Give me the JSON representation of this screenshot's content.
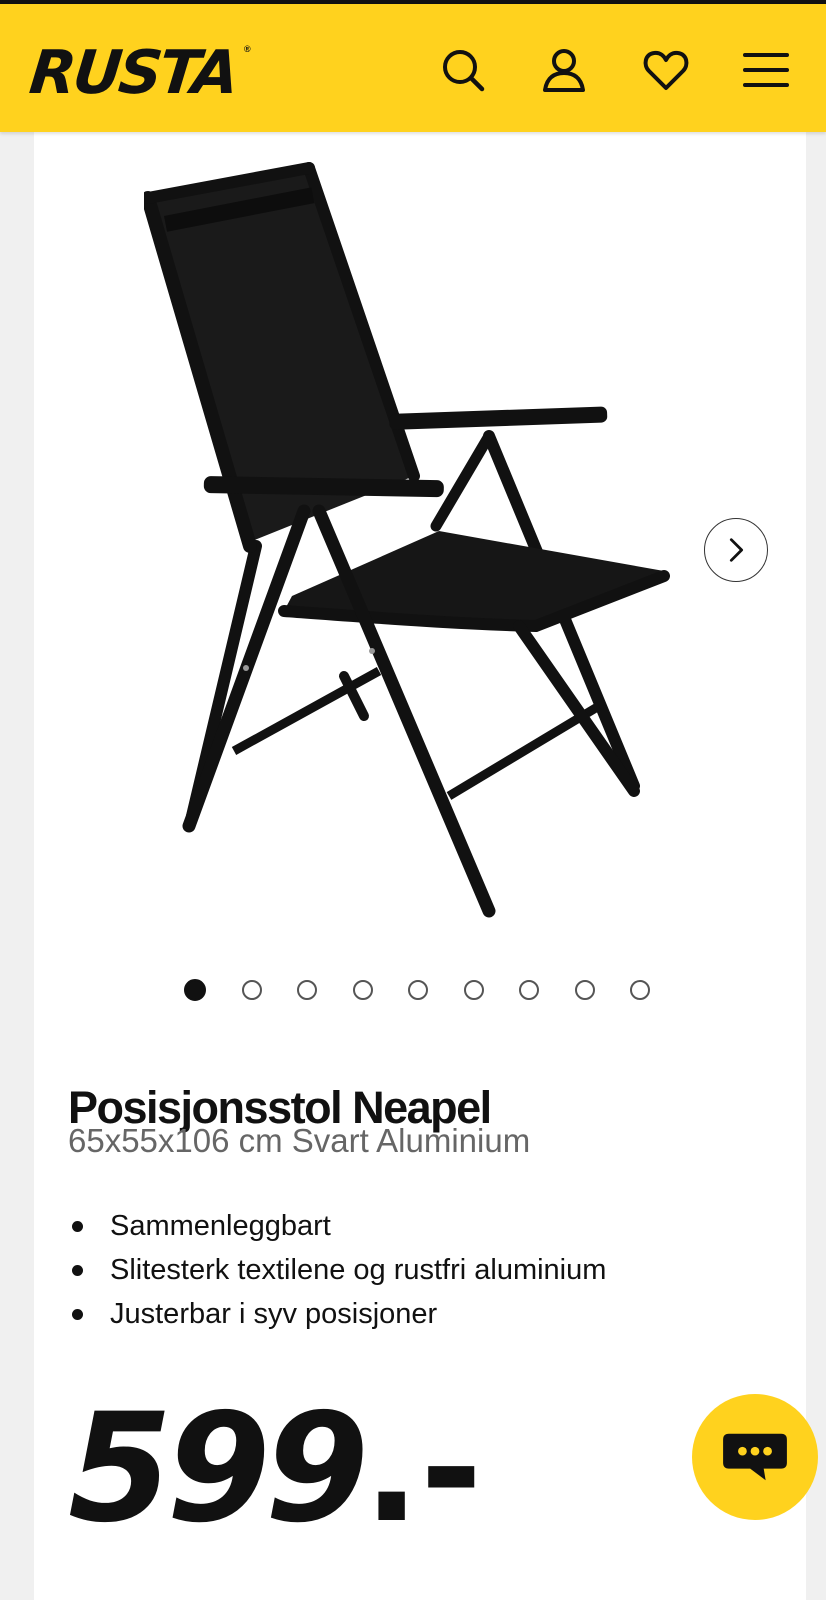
{
  "header": {
    "logo_text": "RUSTA",
    "logo_mark": "®",
    "brand_color": "#ffd21e",
    "icons": [
      "search-icon",
      "account-icon",
      "favorites-heart-icon",
      "menu-hamburger-icon"
    ]
  },
  "product": {
    "image_alt": "Posisjonsstol Neapel",
    "gallery": {
      "image_count": 9,
      "active_index": 1,
      "next_icon": "chevron-right-icon"
    },
    "title": "Posisjonsstol Neapel",
    "subtitle": "65x55x106 cm Svart Aluminium",
    "features": [
      "Sammenleggbart",
      "Slitesterk textilene og rustfri aluminium",
      "Justerbar i syv posisjoner"
    ],
    "price": "599",
    "price_suffix": ".-"
  },
  "chat": {
    "icon": "chat-bubble-icon",
    "color": "#ffd21e"
  }
}
